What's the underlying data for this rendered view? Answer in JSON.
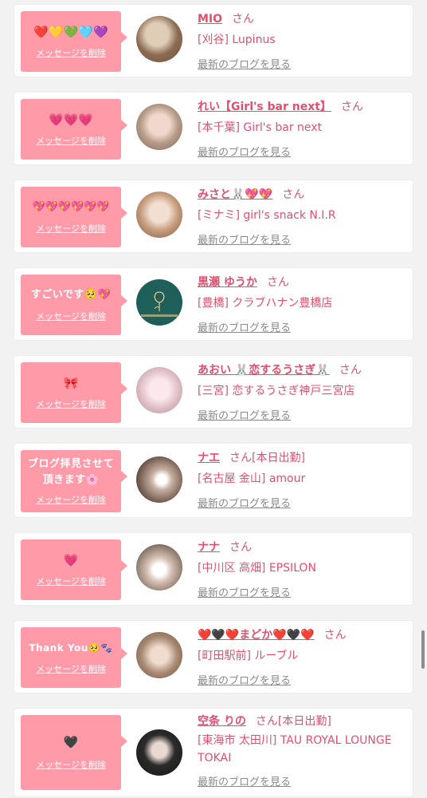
{
  "entries": [
    {
      "message": "❤️💛💚🩵💜",
      "delete_label": "メッセージを削除",
      "name": "MIO",
      "honorific": "さん",
      "status": "",
      "shop": "[刈谷] Lupinus",
      "blog_link": "最新のブログを見る"
    },
    {
      "message": "💗💗💗",
      "delete_label": "メッセージを削除",
      "name": "れい【Girl's bar next】",
      "honorific": "さん",
      "status": "",
      "shop": "[本千葉] Girl's bar next",
      "blog_link": "最新のブログを見る"
    },
    {
      "message": "💖💖💖💖💖💖",
      "delete_label": "メッセージを削除",
      "name": "みさと🐰💖💖",
      "honorific": "さん",
      "status": "",
      "shop": "[ミナミ] girl's snack N.I.R",
      "blog_link": "最新のブログを見る"
    },
    {
      "message": "すごいです🥺💖",
      "delete_label": "メッセージを削除",
      "name": "黒瀬 ゆうか",
      "honorific": "さん",
      "status": "",
      "shop": "[豊橋] クラブハナン豊橋店",
      "blog_link": "最新のブログを見る"
    },
    {
      "message": "🎀",
      "delete_label": "メッセージを削除",
      "name": "あおい 🐰恋するうさぎ🐰",
      "honorific": "さん",
      "status": "",
      "shop": "[三宮] 恋するうさぎ神戸三宮店",
      "blog_link": "最新のブログを見る"
    },
    {
      "message": "ブログ拝見させて頂きます🌸",
      "delete_label": "メッセージを削除",
      "name": "ナエ",
      "honorific": "さん",
      "status": "[本日出勤]",
      "shop": "[名古屋 金山] amour",
      "blog_link": "最新のブログを見る"
    },
    {
      "message": "💗",
      "delete_label": "メッセージを削除",
      "name": "ナナ",
      "honorific": "さん",
      "status": "",
      "shop": "[中川区 高畑] EPSILON",
      "blog_link": "最新のブログを見る"
    },
    {
      "message": "Thank You🥺🐾",
      "delete_label": "メッセージを削除",
      "name": "❤️🖤❤️まどか❤️🖤❤️",
      "honorific": "さん",
      "status": "",
      "shop": "[町田駅前] ルーブル",
      "blog_link": "最新のブログを見る"
    },
    {
      "message": "🖤",
      "delete_label": "メッセージを削除",
      "name": "空条 りの",
      "honorific": "さん",
      "status": "[本日出勤]",
      "shop": "[東海市 太田川] TAU ROYAL LOUNGE TOKAI",
      "blog_link": "最新のブログを見る"
    }
  ],
  "colors": {
    "bubble": "#ff9aa9",
    "accent": "#e0506e",
    "muted": "#8a8a8a",
    "background": "#f2f2f2"
  },
  "avatar_icons": [
    "profile-photo",
    "profile-photo",
    "profile-photo",
    "shop-logo-photo",
    "profile-photo",
    "profile-photo",
    "profile-photo",
    "profile-photo",
    "profile-photo"
  ]
}
